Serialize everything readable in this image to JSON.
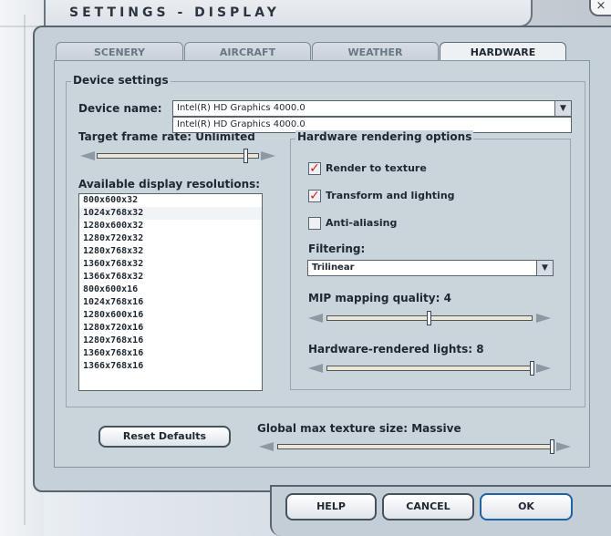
{
  "title": "SETTINGS - DISPLAY",
  "tabs": {
    "scenery": "SCENERY",
    "aircraft": "AIRCRAFT",
    "weather": "WEATHER",
    "hardware": "HARDWARE"
  },
  "device": {
    "group_label": "Device settings",
    "name_label": "Device name:",
    "selected": "Intel(R) HD Graphics 4000.0",
    "options": [
      "Intel(R) HD Graphics 4000.0"
    ]
  },
  "target_frame_rate": {
    "label": "Target frame rate: Unlimited",
    "level": 0.92
  },
  "resolutions": {
    "label": "Available display resolutions:",
    "items": [
      "800x600x32",
      "1024x768x32",
      "1280x600x32",
      "1280x720x32",
      "1280x768x32",
      "1360x768x32",
      "1366x768x32",
      "800x600x16",
      "1024x768x16",
      "1280x600x16",
      "1280x720x16",
      "1280x768x16",
      "1360x768x16",
      "1366x768x16"
    ],
    "selected_index": 1
  },
  "hardware_options": {
    "group_label": "Hardware rendering options",
    "render_to_texture": {
      "label": "Render to texture",
      "checked": true
    },
    "transform_lighting": {
      "label": "Transform and lighting",
      "checked": true
    },
    "anti_aliasing": {
      "label": "Anti-aliasing",
      "checked": false
    },
    "filtering_label": "Filtering:",
    "filtering_value": "Trilinear",
    "mip_label": "MIP mapping quality: 4",
    "mip_level": 0.5,
    "lights_label": "Hardware-rendered lights: 8",
    "lights_level": 1.0
  },
  "reset_button": "Reset Defaults",
  "texture_size": {
    "label": "Global max texture size: Massive",
    "level": 1.0
  },
  "buttons": {
    "help": "HELP",
    "cancel": "CANCEL",
    "ok": "OK"
  },
  "colors": {
    "check_mark": "#d51f1f",
    "ok_border": "#1e63a6"
  }
}
